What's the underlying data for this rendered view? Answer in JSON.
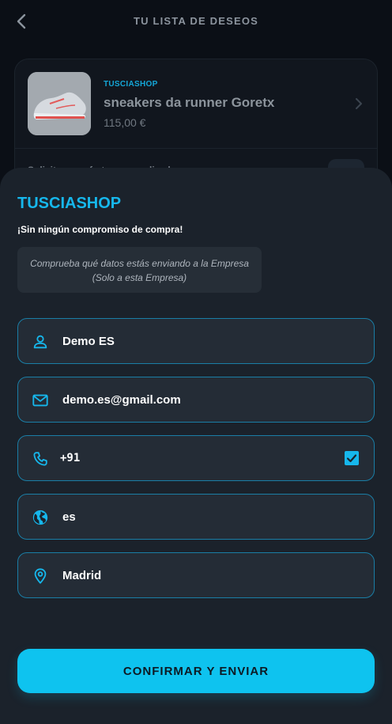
{
  "header": {
    "title": "TU LISTA DE DESEOS",
    "back_icon": "chevron-left-icon"
  },
  "product": {
    "brand": "TUSCIASHOP",
    "name": "sneakers da runner Goretx",
    "price": "115,00 €",
    "request_label": "Solicita una oferta personalizada"
  },
  "sheet": {
    "shop_name": "TUSCIASHOP",
    "no_commitment": "¡Sin ningún compromiso de compra!",
    "info_line1": "Comprueba qué datos estás enviando a la Empresa",
    "info_line2": "(Solo a esta Empresa)",
    "fields": {
      "name": "Demo ES",
      "email": "demo.es@gmail.com",
      "phone": "+91",
      "language": "es",
      "city": "Madrid"
    },
    "phone_checked": true,
    "confirm_label": "CONFIRMAR Y ENVIAR"
  },
  "colors": {
    "accent": "#16b7ec",
    "button": "#0ec3ef",
    "sheet_bg": "#1b222b",
    "page_bg": "#0b0f16"
  }
}
